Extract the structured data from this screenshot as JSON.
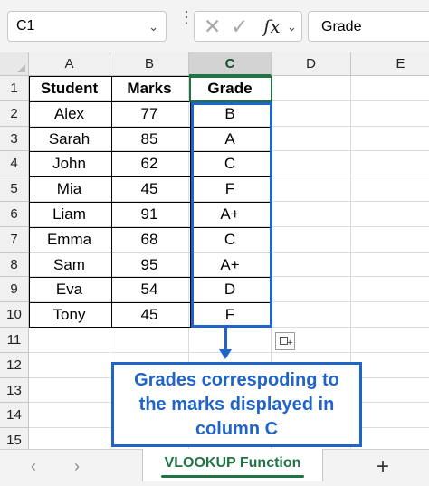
{
  "formula_bar": {
    "name_box": "C1",
    "formula": "Grade",
    "cancel_glyph": "✕",
    "enter_glyph": "✓",
    "fx_label": "fx"
  },
  "columns": [
    "A",
    "B",
    "C",
    "D",
    "E"
  ],
  "rows": [
    "1",
    "2",
    "3",
    "4",
    "5",
    "6",
    "7",
    "8",
    "9",
    "10",
    "11",
    "12",
    "13",
    "14",
    "15"
  ],
  "table": {
    "headers": [
      "Student",
      "Marks",
      "Grade"
    ],
    "data": [
      [
        "Alex",
        "77",
        "B"
      ],
      [
        "Sarah",
        "85",
        "A"
      ],
      [
        "John",
        "62",
        "C"
      ],
      [
        "Mia",
        "45",
        "F"
      ],
      [
        "Liam",
        "91",
        "A+"
      ],
      [
        "Emma",
        "68",
        "C"
      ],
      [
        "Sam",
        "95",
        "A+"
      ],
      [
        "Eva",
        "54",
        "D"
      ],
      [
        "Tony",
        "45",
        "F"
      ]
    ]
  },
  "selected_cell": "C1",
  "annotation": {
    "lines": [
      "Grades correspoding to",
      "the marks displayed in",
      "column C"
    ],
    "color": "#1f64c8"
  },
  "sheet_tabs": {
    "prev": "‹",
    "next": "›",
    "active": "VLOOKUP Function",
    "add": "+"
  },
  "colors": {
    "accent": "#217346",
    "annotation": "#1f64c8"
  }
}
